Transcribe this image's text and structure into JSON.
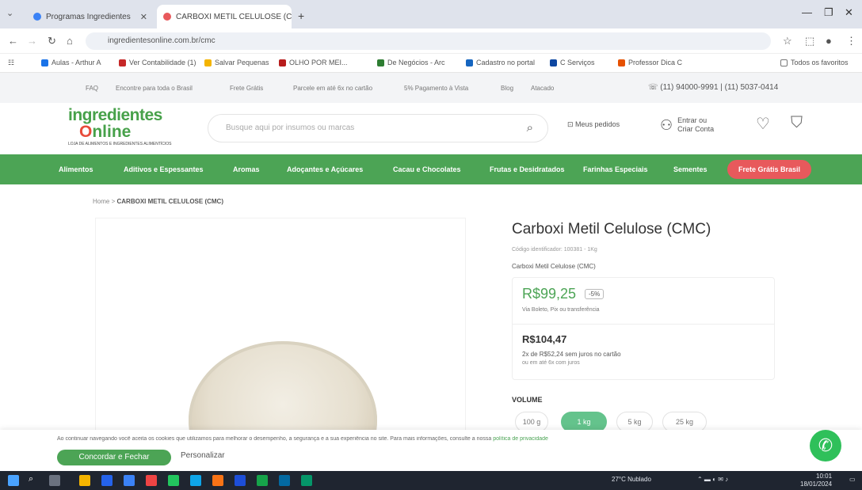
{
  "browser": {
    "tabs": [
      {
        "label": "Programas Ingredientes"
      },
      {
        "label": "CARBOXI METIL CELULOSE (C..."
      }
    ],
    "url": "ingredientesonline.com.br/cmc",
    "bookmarks": [
      "Aulas - Arthur A",
      "Ver Contabilidade (1)",
      "Salvar Pequenas",
      "OLHO POR MEI...",
      "De Negócios - Arc",
      "Cadastro no portal",
      "C Serviços",
      "Professor Dica C"
    ],
    "bookmarks_right": "Todos os favoritos"
  },
  "toplinks": {
    "items": [
      "FAQ",
      "Encontre para toda o Brasil",
      "Frete Grátis",
      "Parcele em até 6x no cartão",
      "5% Pagamento à Vista",
      "Blog",
      "Atacado"
    ],
    "phone": "(11) 94000-9991 | (11) 5037-0414"
  },
  "header": {
    "logo_line1": "ingredientes",
    "logo_o": "O",
    "logo_line2": "nline",
    "logo_tagline": "LOJA DE ALIMENTOS E INGREDIENTES ALIMENTÍCIOS",
    "search_placeholder": "Busque aqui por insumos ou marcas",
    "track_orders": "Meus pedidos",
    "login_line1": "Entrar  ou",
    "login_line2": "Criar Conta"
  },
  "nav": {
    "items": [
      "Alimentos",
      "Aditivos e Espessantes",
      "Aromas",
      "Adoçantes e Açúcares",
      "Cacau e Chocolates",
      "Frutas e Desidratados",
      "Farinhas Especiais",
      "Sementes"
    ],
    "highlight": "Frete Grátis Brasil"
  },
  "breadcrumb": {
    "home": "Home",
    "sep": ">",
    "current": "CARBOXI METIL CELULOSE (CMC)"
  },
  "product": {
    "title": "Carboxi Metil Celulose (CMC)",
    "code": "Código identificador: 100381 - 1Kg",
    "subtitle": "Carboxi Metil Celulose (CMC)",
    "pix_price": "R$99,25",
    "discount": "-5%",
    "pix_note": "Via Boleto, Pix ou transferência",
    "card_price": "R$104,47",
    "installments": "2x de R$52,24 sem juros no cartão",
    "installments_note": "ou em até 6x com juros",
    "volume_label": "VOLUME",
    "volume_options": [
      "100 g",
      "1 kg",
      "5 kg",
      "25 kg"
    ],
    "volume_selected": "1 kg"
  },
  "cookie": {
    "text": "Ao continuar navegando você aceita os cookies que utilizamos para melhorar o desempenho, a segurança e a sua experiência no site. Para mais informações, consulte a nossa",
    "link": "política de privacidade",
    "accept": "Concordar e Fechar",
    "customize": "Personalizar"
  },
  "taskbar": {
    "weather": "27°C  Nublado",
    "time": "10:01",
    "date": "18/01/2024"
  },
  "colors": {
    "brand_green": "#4ca455",
    "accent_red": "#e8595c",
    "pix_green": "#4ca455",
    "selected_volume": "#64c38c",
    "whatsapp": "#2fc05a"
  }
}
